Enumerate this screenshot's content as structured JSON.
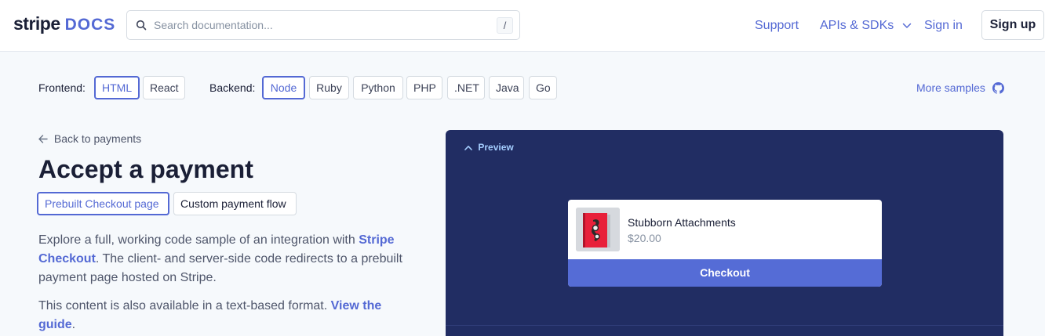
{
  "header": {
    "logo_primary": "stripe",
    "logo_secondary": "DOCS",
    "search_placeholder": "Search documentation...",
    "search_shortcut": "/",
    "nav": {
      "support": "Support",
      "apis": "APIs & SDKs",
      "signin": "Sign in",
      "signup": "Sign up"
    }
  },
  "filters": {
    "frontend_label": "Frontend:",
    "frontend_options": [
      {
        "label": "HTML",
        "selected": true
      },
      {
        "label": "React",
        "selected": false
      }
    ],
    "backend_label": "Backend:",
    "backend_options": [
      {
        "label": "Node",
        "selected": true
      },
      {
        "label": "Ruby",
        "selected": false
      },
      {
        "label": "Python",
        "selected": false
      },
      {
        "label": "PHP",
        "selected": false
      },
      {
        "label": ".NET",
        "selected": false
      },
      {
        "label": "Java",
        "selected": false
      },
      {
        "label": "Go",
        "selected": false
      }
    ],
    "more_samples": "More samples"
  },
  "content": {
    "back_link": "Back to payments",
    "title": "Accept a payment",
    "tabs": [
      {
        "label": "Prebuilt Checkout page",
        "selected": true
      },
      {
        "label": "Custom payment flow",
        "selected": false
      }
    ],
    "para1_text1": "Explore a full, working code sample of an integration with ",
    "para1_link": "Stripe Checkout",
    "para1_text2": ". The client- and server-side code redirects to a prebuilt payment page hosted on Stripe.",
    "para2_text1": "This content is also available in a text-based format. ",
    "para2_link": "View the guide",
    "para2_text2": "."
  },
  "preview": {
    "toggle_label": "Preview",
    "product_name": "Stubborn Attachments",
    "product_price": "$20.00",
    "checkout_label": "Checkout"
  },
  "colors": {
    "accent": "#5469d4",
    "preview_bg": "#212d63",
    "checkout_button": "#556cd6"
  }
}
